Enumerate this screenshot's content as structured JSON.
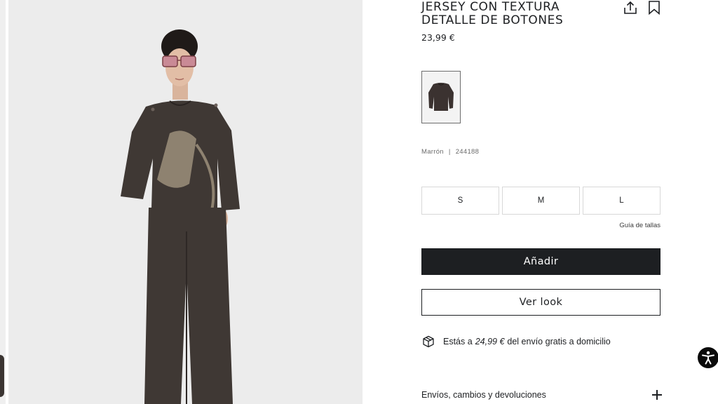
{
  "product": {
    "title_line1": "JERSEY CON TEXTURA",
    "title_line2": "DETALLE DE BOTONES",
    "price": "23,99 €",
    "color": "Marrón",
    "separator": "|",
    "reference": "244188"
  },
  "actions": {
    "share_icon": "share-icon",
    "bookmark_icon": "bookmark-icon"
  },
  "sizes": [
    "S",
    "M",
    "L"
  ],
  "size_guide_label": "Guía de tallas",
  "add_label": "Añadir",
  "look_label": "Ver look",
  "shipping": {
    "icon": "package-icon",
    "prefix": "Estás a",
    "amount": "24,99 €",
    "suffix": "del envío gratis a domicilio"
  },
  "accordion": {
    "label": "Envíos, cambios y devoluciones",
    "icon": "plus-icon"
  },
  "accessibility_icon": "accessibility-icon",
  "colors": {
    "primary": "#1d1f22",
    "garment": "#3f3834",
    "photo_bg": "#ededed"
  }
}
